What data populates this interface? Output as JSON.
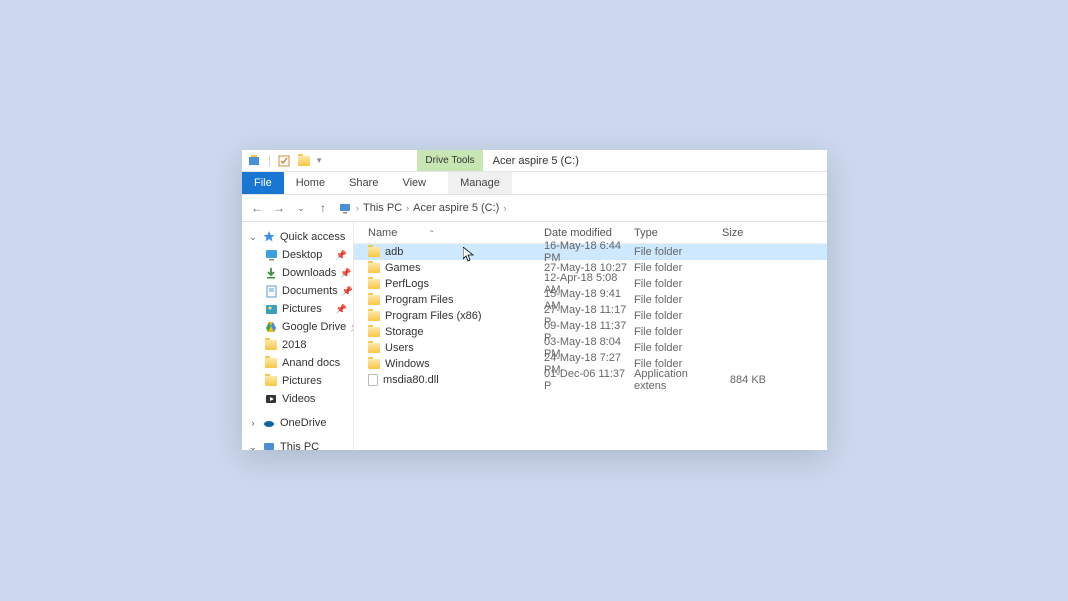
{
  "titlebar": {
    "drive_tools_label": "Drive Tools",
    "title": "Acer aspire 5 (C:)"
  },
  "ribbon": {
    "file": "File",
    "home": "Home",
    "share": "Share",
    "view": "View",
    "manage": "Manage"
  },
  "address": {
    "root": "This PC",
    "current": "Acer aspire 5 (C:)"
  },
  "columns": {
    "name": "Name",
    "date": "Date modified",
    "type": "Type",
    "size": "Size"
  },
  "sidebar": {
    "quick_access": "Quick access",
    "items": [
      {
        "label": "Desktop",
        "icon": "desktop",
        "pinned": true
      },
      {
        "label": "Downloads",
        "icon": "downloads",
        "pinned": true
      },
      {
        "label": "Documents",
        "icon": "documents",
        "pinned": true
      },
      {
        "label": "Pictures",
        "icon": "pictures",
        "pinned": true
      },
      {
        "label": "Google Drive",
        "icon": "gdrive",
        "pinned": true
      },
      {
        "label": "2018",
        "icon": "folder",
        "pinned": false
      },
      {
        "label": "Anand docs",
        "icon": "folder",
        "pinned": false
      },
      {
        "label": "Pictures",
        "icon": "folder",
        "pinned": false
      },
      {
        "label": "Videos",
        "icon": "videos",
        "pinned": false
      }
    ],
    "onedrive": "OneDrive",
    "thispc": "This PC"
  },
  "files": [
    {
      "name": "adb",
      "date": "16-May-18 6:44 PM",
      "type": "File folder",
      "size": "",
      "icon": "folder",
      "selected": true
    },
    {
      "name": "Games",
      "date": "27-May-18 10:27",
      "type": "File folder",
      "size": "",
      "icon": "folder"
    },
    {
      "name": "PerfLogs",
      "date": "12-Apr-18 5:08 AM",
      "type": "File folder",
      "size": "",
      "icon": "folder"
    },
    {
      "name": "Program Files",
      "date": "15-May-18 9:41 AM",
      "type": "File folder",
      "size": "",
      "icon": "folder"
    },
    {
      "name": "Program Files (x86)",
      "date": "27-May-18 11:17 P",
      "type": "File folder",
      "size": "",
      "icon": "folder"
    },
    {
      "name": "Storage",
      "date": "09-May-18 11:37 P",
      "type": "File folder",
      "size": "",
      "icon": "folder"
    },
    {
      "name": "Users",
      "date": "03-May-18 8:04 PM",
      "type": "File folder",
      "size": "",
      "icon": "folder"
    },
    {
      "name": "Windows",
      "date": "24-May-18 7:27 PM",
      "type": "File folder",
      "size": "",
      "icon": "folder"
    },
    {
      "name": "msdia80.dll",
      "date": "01-Dec-06 11:37 P",
      "type": "Application extens",
      "size": "884 KB",
      "icon": "file"
    }
  ]
}
